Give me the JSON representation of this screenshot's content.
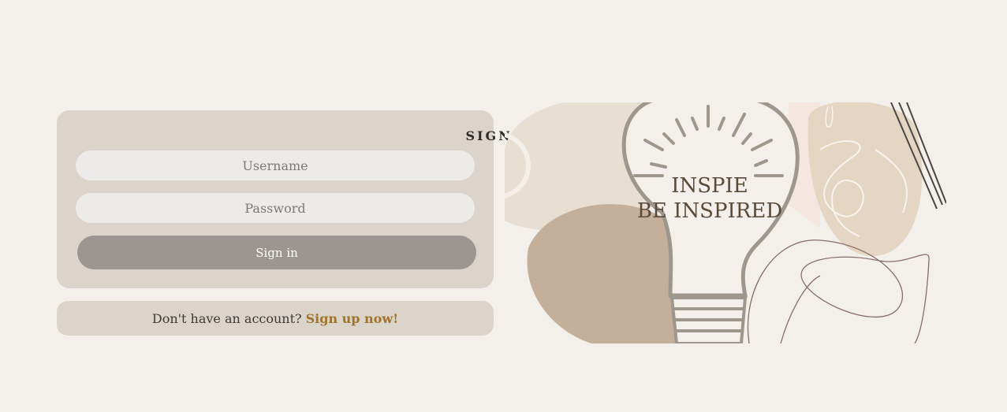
{
  "signin": {
    "title": "SIGN IN",
    "username_placeholder": "Username",
    "password_placeholder": "Password",
    "button_label": "Sign in"
  },
  "signup": {
    "prompt": "Don't have an account?",
    "link_label": "Sign up now!"
  },
  "illustration": {
    "line1": "INSPIE",
    "line2": "BE INSPIRED"
  },
  "colors": {
    "background": "#f3f0eb",
    "card": "#dbd4ca",
    "field": "#ecebe9",
    "button": "#9b9790",
    "link": "#a0742b",
    "illustration_text": "#5a4a38"
  }
}
